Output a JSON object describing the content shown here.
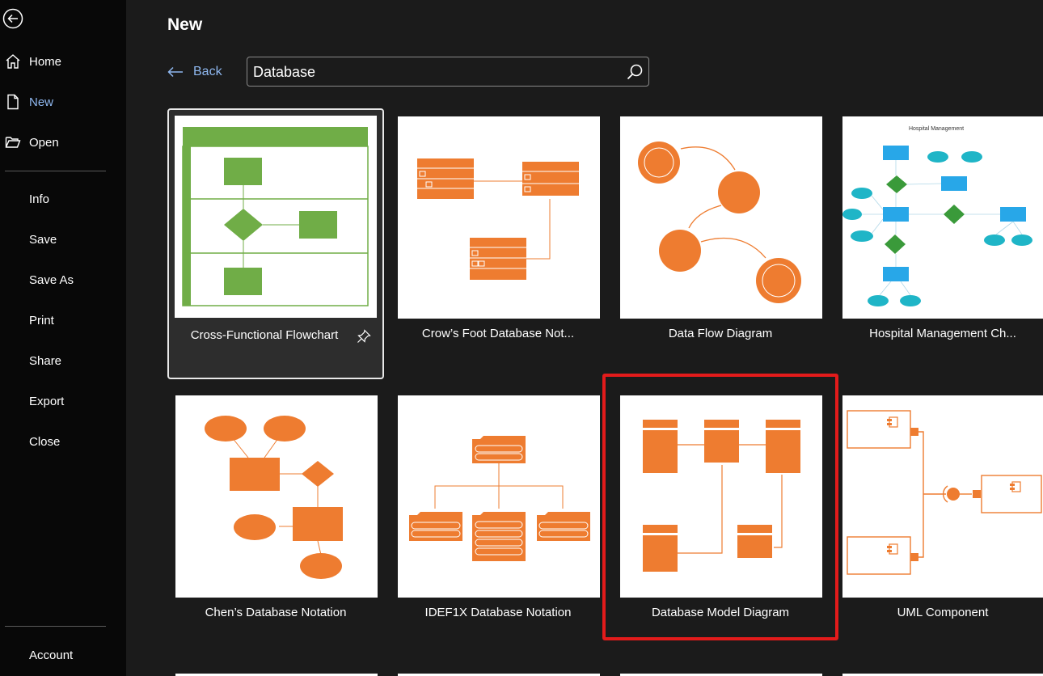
{
  "sidebar": {
    "items": [
      {
        "label": "Home"
      },
      {
        "label": "New"
      },
      {
        "label": "Open"
      },
      {
        "label": "Info"
      },
      {
        "label": "Save"
      },
      {
        "label": "Save As"
      },
      {
        "label": "Print"
      },
      {
        "label": "Share"
      },
      {
        "label": "Export"
      },
      {
        "label": "Close"
      }
    ],
    "account": "Account"
  },
  "header": {
    "title": "New"
  },
  "toolbar": {
    "back_label": "Back"
  },
  "search": {
    "value": "Database"
  },
  "templates": [
    {
      "name": "Cross-Functional Flowchart"
    },
    {
      "name": "Crow’s Foot Database Not..."
    },
    {
      "name": "Data Flow Diagram"
    },
    {
      "name": "Hospital Management Ch..."
    },
    {
      "name": "Chen’s Database Notation"
    },
    {
      "name": "IDEF1X Database Notation"
    },
    {
      "name": "Database Model Diagram"
    },
    {
      "name": "UML Component"
    }
  ],
  "thumbnail_text": {
    "hospital_title": "Hospital Management"
  },
  "colors": {
    "accent_link": "#8fb8f0",
    "highlight": "#e31b1b",
    "diagram_orange": "#ee7c30",
    "diagram_green": "#70ad47",
    "diagram_cyan": "#1fb5c7",
    "diagram_blue": "#28a7e8"
  }
}
